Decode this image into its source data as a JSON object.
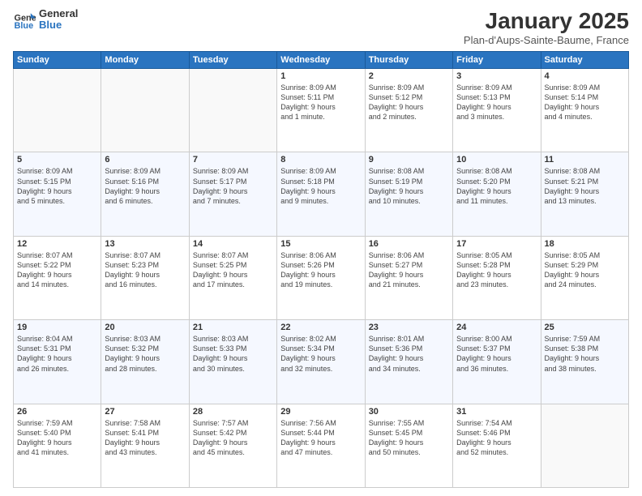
{
  "header": {
    "logo_line1": "General",
    "logo_line2": "Blue",
    "title": "January 2025",
    "subtitle": "Plan-d'Aups-Sainte-Baume, France"
  },
  "weekdays": [
    "Sunday",
    "Monday",
    "Tuesday",
    "Wednesday",
    "Thursday",
    "Friday",
    "Saturday"
  ],
  "weeks": [
    [
      {
        "day": "",
        "info": ""
      },
      {
        "day": "",
        "info": ""
      },
      {
        "day": "",
        "info": ""
      },
      {
        "day": "1",
        "info": "Sunrise: 8:09 AM\nSunset: 5:11 PM\nDaylight: 9 hours\nand 1 minute."
      },
      {
        "day": "2",
        "info": "Sunrise: 8:09 AM\nSunset: 5:12 PM\nDaylight: 9 hours\nand 2 minutes."
      },
      {
        "day": "3",
        "info": "Sunrise: 8:09 AM\nSunset: 5:13 PM\nDaylight: 9 hours\nand 3 minutes."
      },
      {
        "day": "4",
        "info": "Sunrise: 8:09 AM\nSunset: 5:14 PM\nDaylight: 9 hours\nand 4 minutes."
      }
    ],
    [
      {
        "day": "5",
        "info": "Sunrise: 8:09 AM\nSunset: 5:15 PM\nDaylight: 9 hours\nand 5 minutes."
      },
      {
        "day": "6",
        "info": "Sunrise: 8:09 AM\nSunset: 5:16 PM\nDaylight: 9 hours\nand 6 minutes."
      },
      {
        "day": "7",
        "info": "Sunrise: 8:09 AM\nSunset: 5:17 PM\nDaylight: 9 hours\nand 7 minutes."
      },
      {
        "day": "8",
        "info": "Sunrise: 8:09 AM\nSunset: 5:18 PM\nDaylight: 9 hours\nand 9 minutes."
      },
      {
        "day": "9",
        "info": "Sunrise: 8:08 AM\nSunset: 5:19 PM\nDaylight: 9 hours\nand 10 minutes."
      },
      {
        "day": "10",
        "info": "Sunrise: 8:08 AM\nSunset: 5:20 PM\nDaylight: 9 hours\nand 11 minutes."
      },
      {
        "day": "11",
        "info": "Sunrise: 8:08 AM\nSunset: 5:21 PM\nDaylight: 9 hours\nand 13 minutes."
      }
    ],
    [
      {
        "day": "12",
        "info": "Sunrise: 8:07 AM\nSunset: 5:22 PM\nDaylight: 9 hours\nand 14 minutes."
      },
      {
        "day": "13",
        "info": "Sunrise: 8:07 AM\nSunset: 5:23 PM\nDaylight: 9 hours\nand 16 minutes."
      },
      {
        "day": "14",
        "info": "Sunrise: 8:07 AM\nSunset: 5:25 PM\nDaylight: 9 hours\nand 17 minutes."
      },
      {
        "day": "15",
        "info": "Sunrise: 8:06 AM\nSunset: 5:26 PM\nDaylight: 9 hours\nand 19 minutes."
      },
      {
        "day": "16",
        "info": "Sunrise: 8:06 AM\nSunset: 5:27 PM\nDaylight: 9 hours\nand 21 minutes."
      },
      {
        "day": "17",
        "info": "Sunrise: 8:05 AM\nSunset: 5:28 PM\nDaylight: 9 hours\nand 23 minutes."
      },
      {
        "day": "18",
        "info": "Sunrise: 8:05 AM\nSunset: 5:29 PM\nDaylight: 9 hours\nand 24 minutes."
      }
    ],
    [
      {
        "day": "19",
        "info": "Sunrise: 8:04 AM\nSunset: 5:31 PM\nDaylight: 9 hours\nand 26 minutes."
      },
      {
        "day": "20",
        "info": "Sunrise: 8:03 AM\nSunset: 5:32 PM\nDaylight: 9 hours\nand 28 minutes."
      },
      {
        "day": "21",
        "info": "Sunrise: 8:03 AM\nSunset: 5:33 PM\nDaylight: 9 hours\nand 30 minutes."
      },
      {
        "day": "22",
        "info": "Sunrise: 8:02 AM\nSunset: 5:34 PM\nDaylight: 9 hours\nand 32 minutes."
      },
      {
        "day": "23",
        "info": "Sunrise: 8:01 AM\nSunset: 5:36 PM\nDaylight: 9 hours\nand 34 minutes."
      },
      {
        "day": "24",
        "info": "Sunrise: 8:00 AM\nSunset: 5:37 PM\nDaylight: 9 hours\nand 36 minutes."
      },
      {
        "day": "25",
        "info": "Sunrise: 7:59 AM\nSunset: 5:38 PM\nDaylight: 9 hours\nand 38 minutes."
      }
    ],
    [
      {
        "day": "26",
        "info": "Sunrise: 7:59 AM\nSunset: 5:40 PM\nDaylight: 9 hours\nand 41 minutes."
      },
      {
        "day": "27",
        "info": "Sunrise: 7:58 AM\nSunset: 5:41 PM\nDaylight: 9 hours\nand 43 minutes."
      },
      {
        "day": "28",
        "info": "Sunrise: 7:57 AM\nSunset: 5:42 PM\nDaylight: 9 hours\nand 45 minutes."
      },
      {
        "day": "29",
        "info": "Sunrise: 7:56 AM\nSunset: 5:44 PM\nDaylight: 9 hours\nand 47 minutes."
      },
      {
        "day": "30",
        "info": "Sunrise: 7:55 AM\nSunset: 5:45 PM\nDaylight: 9 hours\nand 50 minutes."
      },
      {
        "day": "31",
        "info": "Sunrise: 7:54 AM\nSunset: 5:46 PM\nDaylight: 9 hours\nand 52 minutes."
      },
      {
        "day": "",
        "info": ""
      }
    ]
  ]
}
